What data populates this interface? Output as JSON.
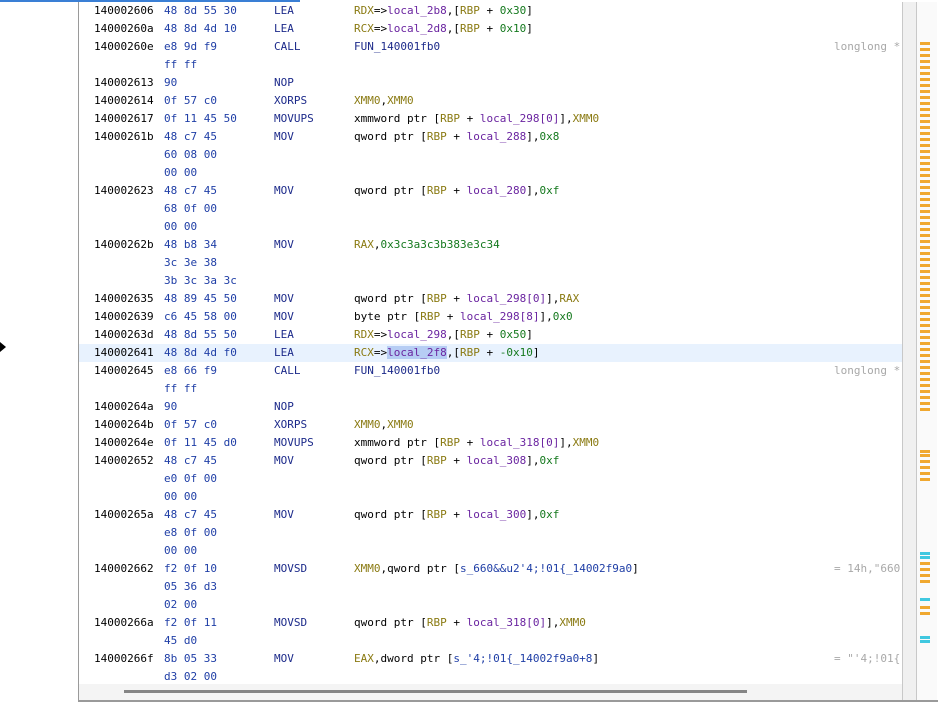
{
  "colors": {
    "selection": "#e8f2fe",
    "highlight": "#b6cdf4",
    "address": "#000000",
    "bytes": "#1f3ea6",
    "mnemonic": "#1c2a8a",
    "register": "#8a7a12",
    "local_var": "#6a24a0",
    "number": "#15791e",
    "comment": "#a8a8a8",
    "overview_marker": "#f0a830",
    "overview_marker_alt": "#40c8e0"
  },
  "listing": [
    {
      "addr": "140002606",
      "bytes": "48 8d 55 30",
      "mnem": "LEA",
      "ops": [
        {
          "t": "RDX",
          "c": "reg"
        },
        {
          "t": "=>",
          "c": "plain"
        },
        {
          "t": "local_2b8",
          "c": "var"
        },
        {
          "t": ",[",
          "c": "plain"
        },
        {
          "t": "RBP",
          "c": "reg"
        },
        {
          "t": " + ",
          "c": "plain"
        },
        {
          "t": "0x30",
          "c": "num"
        },
        {
          "t": "]",
          "c": "plain"
        }
      ],
      "comment": ""
    },
    {
      "addr": "14000260a",
      "bytes": "48 8d 4d 10",
      "mnem": "LEA",
      "ops": [
        {
          "t": "RCX",
          "c": "reg"
        },
        {
          "t": "=>",
          "c": "plain"
        },
        {
          "t": "local_2d8",
          "c": "var"
        },
        {
          "t": ",[",
          "c": "plain"
        },
        {
          "t": "RBP",
          "c": "reg"
        },
        {
          "t": " + ",
          "c": "plain"
        },
        {
          "t": "0x10",
          "c": "num"
        },
        {
          "t": "]",
          "c": "plain"
        }
      ],
      "comment": ""
    },
    {
      "addr": "14000260e",
      "bytes": "e8 9d f9",
      "mnem": "CALL",
      "ops": [
        {
          "t": "FUN_140001fb0",
          "c": "fun"
        }
      ],
      "comment": "longlong *"
    },
    {
      "addr": "",
      "bytes": "ff ff",
      "mnem": "",
      "ops": [],
      "comment": ""
    },
    {
      "addr": "140002613",
      "bytes": "90",
      "mnem": "NOP",
      "ops": [],
      "comment": ""
    },
    {
      "addr": "140002614",
      "bytes": "0f 57 c0",
      "mnem": "XORPS",
      "ops": [
        {
          "t": "XMM0",
          "c": "reg"
        },
        {
          "t": ",",
          "c": "plain"
        },
        {
          "t": "XMM0",
          "c": "reg"
        }
      ],
      "comment": ""
    },
    {
      "addr": "140002617",
      "bytes": "0f 11 45 50",
      "mnem": "MOVUPS",
      "ops": [
        {
          "t": "xmmword ptr [",
          "c": "plain"
        },
        {
          "t": "RBP",
          "c": "reg"
        },
        {
          "t": " + ",
          "c": "plain"
        },
        {
          "t": "local_298[0]",
          "c": "var"
        },
        {
          "t": "],",
          "c": "plain"
        },
        {
          "t": "XMM0",
          "c": "reg"
        }
      ],
      "comment": ""
    },
    {
      "addr": "14000261b",
      "bytes": "48 c7 45",
      "mnem": "MOV",
      "ops": [
        {
          "t": "qword ptr [",
          "c": "plain"
        },
        {
          "t": "RBP",
          "c": "reg"
        },
        {
          "t": " + ",
          "c": "plain"
        },
        {
          "t": "local_288",
          "c": "var"
        },
        {
          "t": "],",
          "c": "plain"
        },
        {
          "t": "0x8",
          "c": "num"
        }
      ],
      "comment": ""
    },
    {
      "addr": "",
      "bytes": "60 08 00",
      "mnem": "",
      "ops": [],
      "comment": ""
    },
    {
      "addr": "",
      "bytes": "00 00",
      "mnem": "",
      "ops": [],
      "comment": ""
    },
    {
      "addr": "140002623",
      "bytes": "48 c7 45",
      "mnem": "MOV",
      "ops": [
        {
          "t": "qword ptr [",
          "c": "plain"
        },
        {
          "t": "RBP",
          "c": "reg"
        },
        {
          "t": " + ",
          "c": "plain"
        },
        {
          "t": "local_280",
          "c": "var"
        },
        {
          "t": "],",
          "c": "plain"
        },
        {
          "t": "0xf",
          "c": "num"
        }
      ],
      "comment": ""
    },
    {
      "addr": "",
      "bytes": "68 0f 00",
      "mnem": "",
      "ops": [],
      "comment": ""
    },
    {
      "addr": "",
      "bytes": "00 00",
      "mnem": "",
      "ops": [],
      "comment": ""
    },
    {
      "addr": "14000262b",
      "bytes": "48 b8 34",
      "mnem": "MOV",
      "ops": [
        {
          "t": "RAX",
          "c": "reg"
        },
        {
          "t": ",",
          "c": "plain"
        },
        {
          "t": "0x3c3a3c3b383e3c34",
          "c": "num"
        }
      ],
      "comment": ""
    },
    {
      "addr": "",
      "bytes": "3c 3e 38",
      "mnem": "",
      "ops": [],
      "comment": ""
    },
    {
      "addr": "",
      "bytes": "3b 3c 3a 3c",
      "mnem": "",
      "ops": [],
      "comment": ""
    },
    {
      "addr": "140002635",
      "bytes": "48 89 45 50",
      "mnem": "MOV",
      "ops": [
        {
          "t": "qword ptr [",
          "c": "plain"
        },
        {
          "t": "RBP",
          "c": "reg"
        },
        {
          "t": " + ",
          "c": "plain"
        },
        {
          "t": "local_298[0]",
          "c": "var"
        },
        {
          "t": "],",
          "c": "plain"
        },
        {
          "t": "RAX",
          "c": "reg"
        }
      ],
      "comment": ""
    },
    {
      "addr": "140002639",
      "bytes": "c6 45 58 00",
      "mnem": "MOV",
      "ops": [
        {
          "t": "byte ptr [",
          "c": "plain"
        },
        {
          "t": "RBP",
          "c": "reg"
        },
        {
          "t": " + ",
          "c": "plain"
        },
        {
          "t": "local_298[8]",
          "c": "var"
        },
        {
          "t": "],",
          "c": "plain"
        },
        {
          "t": "0x0",
          "c": "num"
        }
      ],
      "comment": ""
    },
    {
      "addr": "14000263d",
      "bytes": "48 8d 55 50",
      "mnem": "LEA",
      "ops": [
        {
          "t": "RDX",
          "c": "reg"
        },
        {
          "t": "=>",
          "c": "plain"
        },
        {
          "t": "local_298",
          "c": "var"
        },
        {
          "t": ",[",
          "c": "plain"
        },
        {
          "t": "RBP",
          "c": "reg"
        },
        {
          "t": " + ",
          "c": "plain"
        },
        {
          "t": "0x50",
          "c": "num"
        },
        {
          "t": "]",
          "c": "plain"
        }
      ],
      "comment": ""
    },
    {
      "addr": "140002641",
      "bytes": "48 8d 4d f0",
      "mnem": "LEA",
      "selected": true,
      "ops": [
        {
          "t": "RCX",
          "c": "reg"
        },
        {
          "t": "=>",
          "c": "plain"
        },
        {
          "t": "local_2f8",
          "c": "var",
          "hl": true
        },
        {
          "t": ",[",
          "c": "plain"
        },
        {
          "t": "RBP",
          "c": "reg"
        },
        {
          "t": " + ",
          "c": "plain"
        },
        {
          "t": "-0x10",
          "c": "num"
        },
        {
          "t": "]",
          "c": "plain"
        }
      ],
      "comment": ""
    },
    {
      "addr": "140002645",
      "bytes": "e8 66 f9",
      "mnem": "CALL",
      "ops": [
        {
          "t": "FUN_140001fb0",
          "c": "fun"
        }
      ],
      "comment": "longlong *"
    },
    {
      "addr": "",
      "bytes": "ff ff",
      "mnem": "",
      "ops": [],
      "comment": ""
    },
    {
      "addr": "14000264a",
      "bytes": "90",
      "mnem": "NOP",
      "ops": [],
      "comment": ""
    },
    {
      "addr": "14000264b",
      "bytes": "0f 57 c0",
      "mnem": "XORPS",
      "ops": [
        {
          "t": "XMM0",
          "c": "reg"
        },
        {
          "t": ",",
          "c": "plain"
        },
        {
          "t": "XMM0",
          "c": "reg"
        }
      ],
      "comment": ""
    },
    {
      "addr": "14000264e",
      "bytes": "0f 11 45 d0",
      "mnem": "MOVUPS",
      "ops": [
        {
          "t": "xmmword ptr [",
          "c": "plain"
        },
        {
          "t": "RBP",
          "c": "reg"
        },
        {
          "t": " + ",
          "c": "plain"
        },
        {
          "t": "local_318[0]",
          "c": "var"
        },
        {
          "t": "],",
          "c": "plain"
        },
        {
          "t": "XMM0",
          "c": "reg"
        }
      ],
      "comment": ""
    },
    {
      "addr": "140002652",
      "bytes": "48 c7 45",
      "mnem": "MOV",
      "ops": [
        {
          "t": "qword ptr [",
          "c": "plain"
        },
        {
          "t": "RBP",
          "c": "reg"
        },
        {
          "t": " + ",
          "c": "plain"
        },
        {
          "t": "local_308",
          "c": "var"
        },
        {
          "t": "],",
          "c": "plain"
        },
        {
          "t": "0xf",
          "c": "num"
        }
      ],
      "comment": ""
    },
    {
      "addr": "",
      "bytes": "e0 0f 00",
      "mnem": "",
      "ops": [],
      "comment": ""
    },
    {
      "addr": "",
      "bytes": "00 00",
      "mnem": "",
      "ops": [],
      "comment": ""
    },
    {
      "addr": "14000265a",
      "bytes": "48 c7 45",
      "mnem": "MOV",
      "ops": [
        {
          "t": "qword ptr [",
          "c": "plain"
        },
        {
          "t": "RBP",
          "c": "reg"
        },
        {
          "t": " + ",
          "c": "plain"
        },
        {
          "t": "local_300",
          "c": "var"
        },
        {
          "t": "],",
          "c": "plain"
        },
        {
          "t": "0xf",
          "c": "num"
        }
      ],
      "comment": ""
    },
    {
      "addr": "",
      "bytes": "e8 0f 00",
      "mnem": "",
      "ops": [],
      "comment": ""
    },
    {
      "addr": "",
      "bytes": "00 00",
      "mnem": "",
      "ops": [],
      "comment": ""
    },
    {
      "addr": "140002662",
      "bytes": "f2 0f 10",
      "mnem": "MOVSD",
      "ops": [
        {
          "t": "XMM0",
          "c": "reg"
        },
        {
          "t": ",qword ptr [",
          "c": "plain"
        },
        {
          "t": "s_660&&u2'4;!01{_14002f9a0",
          "c": "str"
        },
        {
          "t": "]",
          "c": "plain"
        }
      ],
      "comment": "= 14h,\"660"
    },
    {
      "addr": "",
      "bytes": "05 36 d3",
      "mnem": "",
      "ops": [],
      "comment": ""
    },
    {
      "addr": "",
      "bytes": "02 00",
      "mnem": "",
      "ops": [],
      "comment": ""
    },
    {
      "addr": "14000266a",
      "bytes": "f2 0f 11",
      "mnem": "MOVSD",
      "ops": [
        {
          "t": "qword ptr [",
          "c": "plain"
        },
        {
          "t": "RBP",
          "c": "reg"
        },
        {
          "t": " + ",
          "c": "plain"
        },
        {
          "t": "local_318[0]",
          "c": "var"
        },
        {
          "t": "],",
          "c": "plain"
        },
        {
          "t": "XMM0",
          "c": "reg"
        }
      ],
      "comment": ""
    },
    {
      "addr": "",
      "bytes": "45 d0",
      "mnem": "",
      "ops": [],
      "comment": ""
    },
    {
      "addr": "14000266f",
      "bytes": "8b 05 33",
      "mnem": "MOV",
      "ops": [
        {
          "t": "EAX",
          "c": "reg"
        },
        {
          "t": ",dword ptr [",
          "c": "plain"
        },
        {
          "t": "s_'4;!01{_14002f9a0+8",
          "c": "str"
        },
        {
          "t": "]",
          "c": "plain"
        }
      ],
      "comment": "= \"'4;!01{"
    },
    {
      "addr": "",
      "bytes": "d3 02 00",
      "mnem": "",
      "ops": [],
      "comment": ""
    }
  ]
}
